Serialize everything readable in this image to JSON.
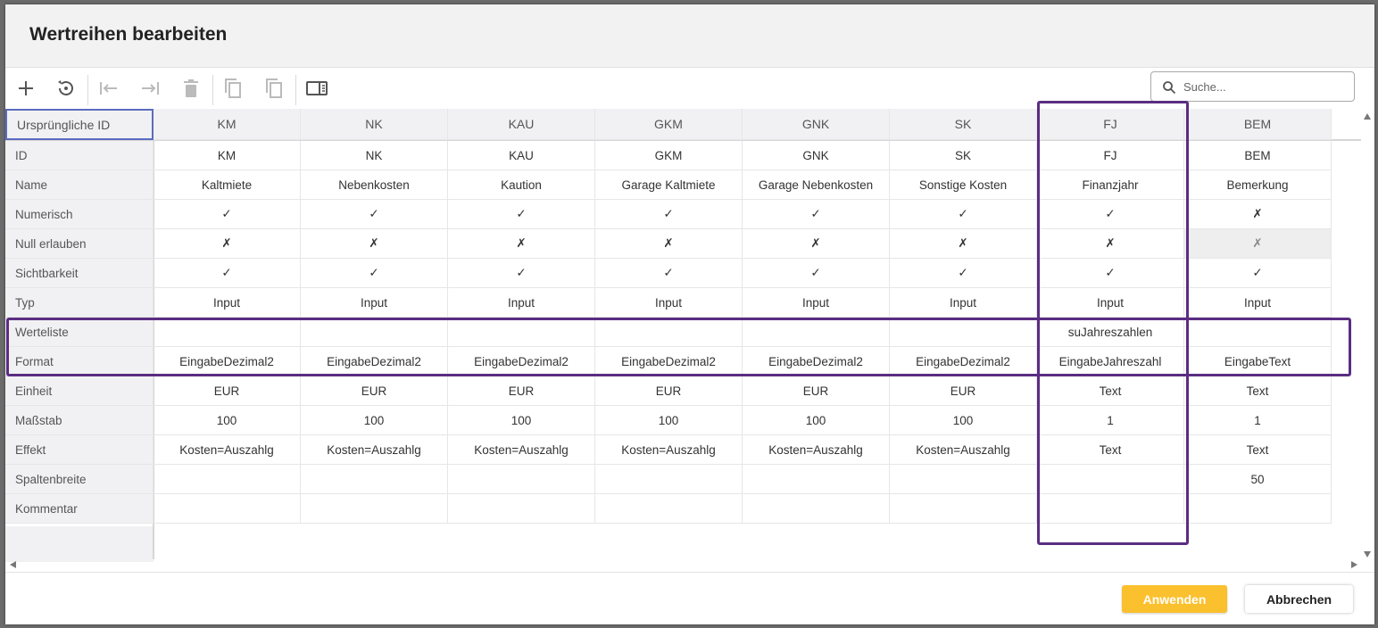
{
  "dialog": {
    "title": "Wertreihen bearbeiten",
    "search_placeholder": "Suche...",
    "apply_label": "Anwenden",
    "cancel_label": "Abbrechen"
  },
  "toolbar": {
    "icons": [
      "plus-icon",
      "reset-icon",
      "move-left-icon",
      "move-right-icon",
      "delete-icon",
      "copy-icon",
      "copy-alt-icon",
      "column-view-icon"
    ]
  },
  "grid": {
    "corner_label": "Ursprüngliche ID",
    "columns": [
      "KM",
      "NK",
      "KAU",
      "GKM",
      "GNK",
      "SK",
      "FJ",
      "BEM"
    ],
    "rows": [
      {
        "label": "ID",
        "values": [
          "KM",
          "NK",
          "KAU",
          "GKM",
          "GNK",
          "SK",
          "FJ",
          "BEM"
        ]
      },
      {
        "label": "Name",
        "values": [
          "Kaltmiete",
          "Nebenkosten",
          "Kaution",
          "Garage Kaltmiete",
          "Garage Nebenkosten",
          "Sonstige Kosten",
          "Finanzjahr",
          "Bemerkung"
        ]
      },
      {
        "label": "Numerisch",
        "values": [
          "✓",
          "✓",
          "✓",
          "✓",
          "✓",
          "✓",
          "✓",
          "✗"
        ]
      },
      {
        "label": "Null erlauben",
        "values": [
          "✗",
          "✗",
          "✗",
          "✗",
          "✗",
          "✗",
          "✗",
          "✗"
        ]
      },
      {
        "label": "Sichtbarkeit",
        "values": [
          "✓",
          "✓",
          "✓",
          "✓",
          "✓",
          "✓",
          "✓",
          "✓"
        ]
      },
      {
        "label": "Typ",
        "values": [
          "Input",
          "Input",
          "Input",
          "Input",
          "Input",
          "Input",
          "Input",
          "Input"
        ]
      },
      {
        "label": "Werteliste",
        "values": [
          "",
          "",
          "",
          "",
          "",
          "",
          "suJahreszahlen",
          ""
        ]
      },
      {
        "label": "Format",
        "values": [
          "EingabeDezimal2",
          "EingabeDezimal2",
          "EingabeDezimal2",
          "EingabeDezimal2",
          "EingabeDezimal2",
          "EingabeDezimal2",
          "EingabeJahreszahl",
          "EingabeText"
        ]
      },
      {
        "label": "Einheit",
        "values": [
          "EUR",
          "EUR",
          "EUR",
          "EUR",
          "EUR",
          "EUR",
          "Text",
          "Text"
        ]
      },
      {
        "label": "Maßstab",
        "values": [
          "100",
          "100",
          "100",
          "100",
          "100",
          "100",
          "1",
          "1"
        ]
      },
      {
        "label": "Effekt",
        "values": [
          "Kosten=Auszahlg",
          "Kosten=Auszahlg",
          "Kosten=Auszahlg",
          "Kosten=Auszahlg",
          "Kosten=Auszahlg",
          "Kosten=Auszahlg",
          "Text",
          "Text"
        ]
      },
      {
        "label": "Spaltenbreite",
        "values": [
          "",
          "",
          "",
          "",
          "",
          "",
          "",
          "50"
        ]
      },
      {
        "label": "Kommentar",
        "values": [
          "",
          "",
          "",
          "",
          "",
          "",
          "",
          ""
        ]
      }
    ],
    "selected_cell": {
      "row": 3,
      "col": 7
    }
  },
  "highlight_color": "#5b2d82",
  "accent_color": "#fbc02d"
}
